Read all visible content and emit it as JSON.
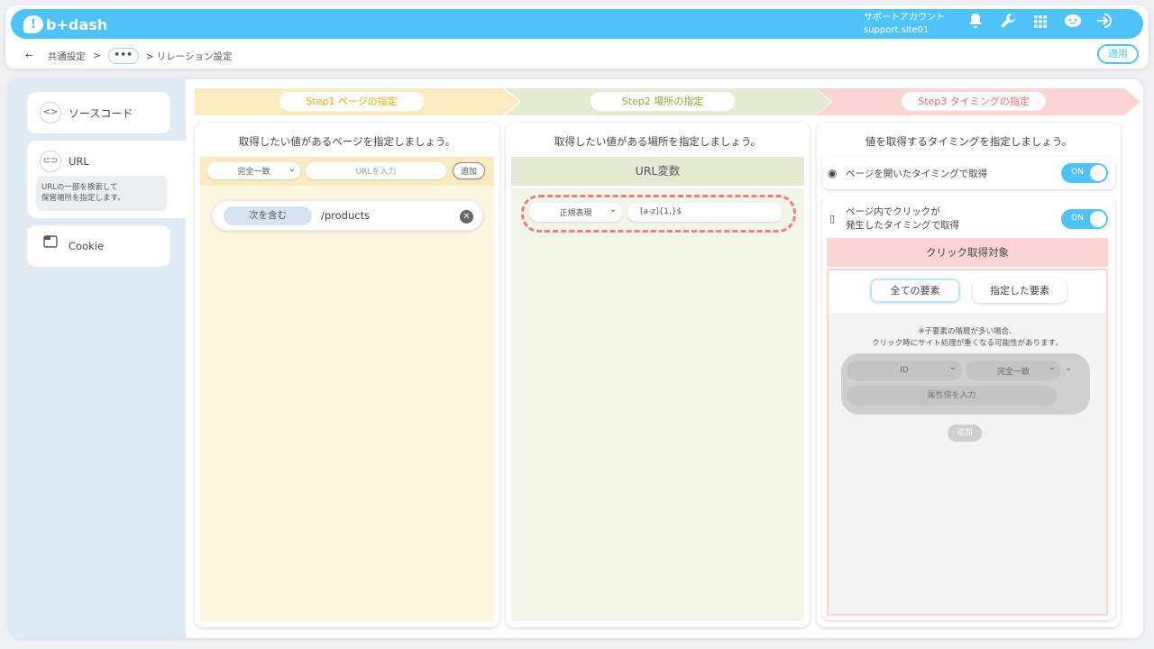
{
  "header": {
    "logo_text": "b+dash",
    "account_name": "サポートアカウント",
    "account_site": "support.site01",
    "icons": [
      "bell-icon",
      "wrench-icon",
      "grid-icon",
      "support-icon",
      "logout-icon"
    ]
  },
  "breadcrumb": {
    "back": "←",
    "item1": "共通設定",
    "sep": ">",
    "ellipsis": "•••",
    "item3": "> リレーション設定"
  },
  "apply_label": "適用",
  "sidebar": {
    "source_code": "ソースコード",
    "url": "URL",
    "url_desc_1": "URLの一部を検索して",
    "url_desc_2": "保管場所を指定します。",
    "cookie": "Cookie"
  },
  "steps": {
    "step1": "Step1 ページの指定",
    "step2": "Step2 場所の指定",
    "step3": "Step3 タイミングの指定"
  },
  "col1": {
    "title": "取得したい値があるページを指定しましょう。",
    "match_select": "完全一致",
    "url_placeholder": "URLを入力",
    "add_label": "追加",
    "rule_type": "次を含む",
    "rule_value": "/products"
  },
  "col2": {
    "title": "取得したい値がある場所を指定しましょう。",
    "section": "URL変数",
    "regex_select": "正規表現",
    "regex_value": "[a-z]{1,}$"
  },
  "col3": {
    "title": "値を取得するタイミングを指定しましょう。",
    "opt1": "ページを開いたタイミングで取得",
    "opt2_line1": "ページ内でクリックが",
    "opt2_line2": "発生したタイミングで取得",
    "toggle": "ON",
    "click_target": "クリック取得対象",
    "tab_all": "全ての要素",
    "tab_specified": "指定した要素",
    "notice_1": "※子要素の階層が多い場合、",
    "notice_2": "クリック時にサイト処理が重くなる可能性があります。",
    "attr_select": "ID",
    "match_select": "完全一致",
    "attr_placeholder": "属性値を入力",
    "add_label": "追加"
  },
  "colors": {
    "accent": "#4fc3f7",
    "step1": "#fbe9bf",
    "step2": "#e5ebd3",
    "step3": "#fcd4d4"
  }
}
